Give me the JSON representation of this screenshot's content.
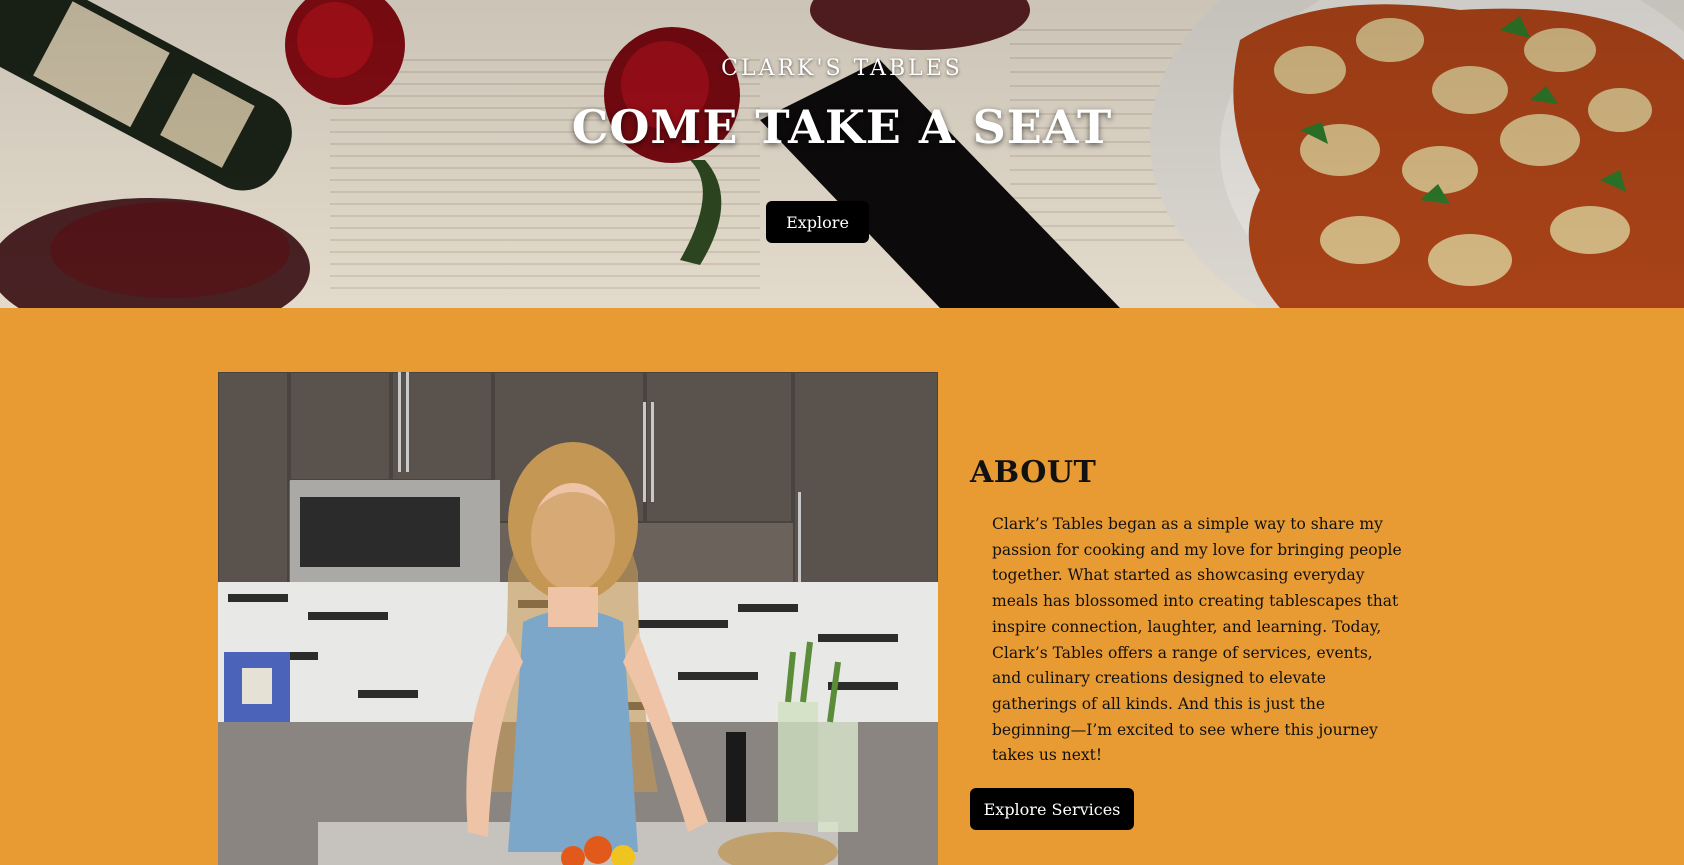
{
  "hero": {
    "brand": "CLARK'S TABLES",
    "title": "COME TAKE A SEAT",
    "button_label": "Explore"
  },
  "about": {
    "heading": "ABOUT",
    "body": "Clark’s Tables began as a simple way to share my passion for cooking and my love for bringing people together. What started as showcasing everyday meals has blossomed into creating tablescapes that inspire connection, laughter, and learning. Today, Clark’s Tables offers a range of services, events, and culinary creations designed to elevate gatherings of all kinds. And this is just the beginning—I’m excited to see where this journey takes us next!",
    "button_label": "Explore Services"
  },
  "colors": {
    "section_background": "#e89a33",
    "button_background": "#000000",
    "button_text": "#ffffff"
  }
}
